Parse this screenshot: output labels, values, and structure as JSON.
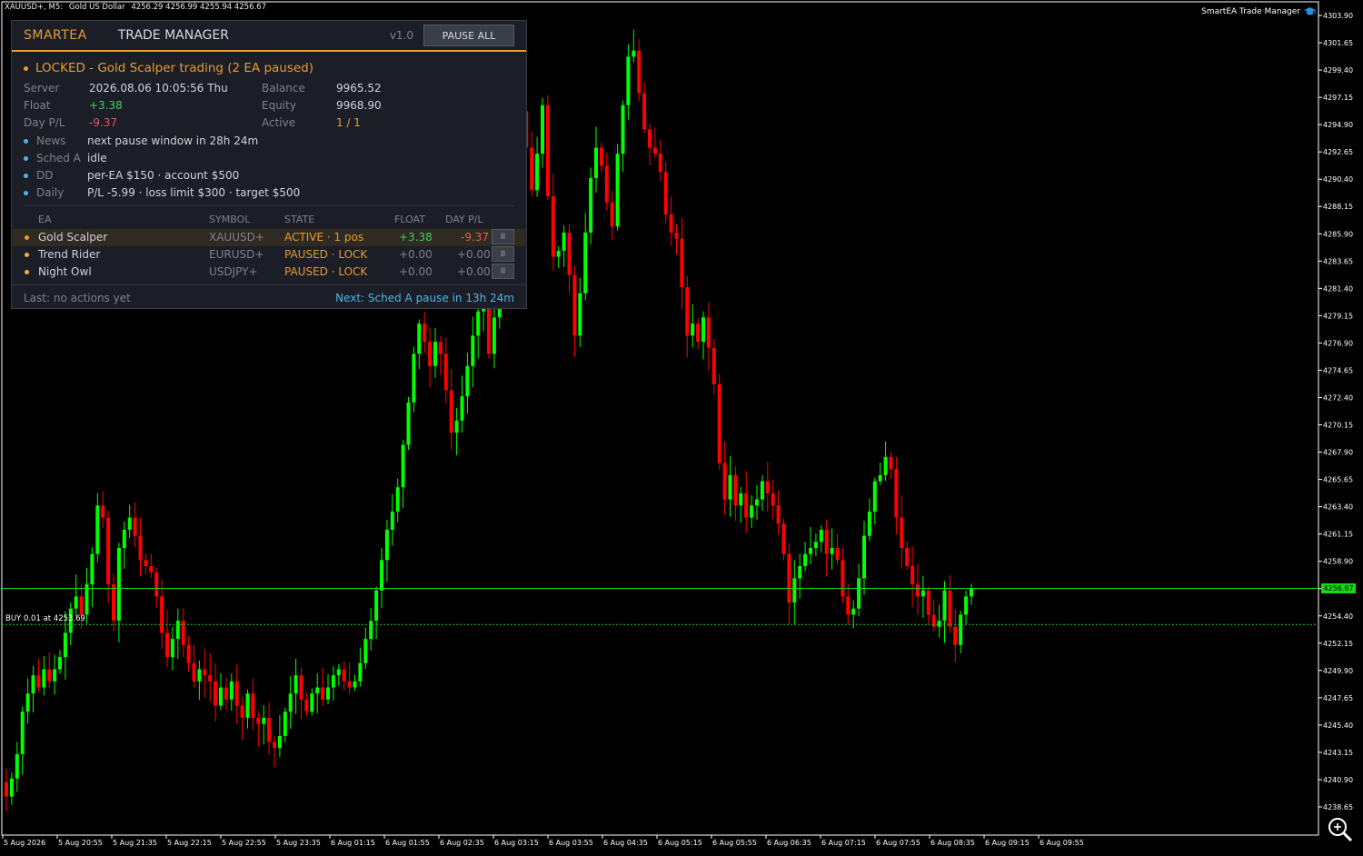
{
  "chart": {
    "symbol_info": "XAUUSD+, M5:",
    "description": "Gold US Dollar",
    "ohlc": "4256.29 4256.99 4255.94 4256.67",
    "brand": "SmartEA Trade Manager",
    "current_price": "4256.67",
    "buy_label": "BUY 0.01 at 4253.69",
    "colors": {
      "bull": "#00ff00",
      "bear": "#ff0000",
      "background": "#000000",
      "grid": "#ffffff"
    }
  },
  "chart_data": {
    "type": "candlestick",
    "title": "",
    "ylim": [
      4237.2,
      4304.2
    ],
    "y_ticks": [
      "4303.90",
      "4301.65",
      "4299.40",
      "4297.15",
      "4294.90",
      "4292.65",
      "4290.40",
      "4288.15",
      "4285.90",
      "4283.65",
      "4281.40",
      "4279.15",
      "4276.90",
      "4274.65",
      "4272.40",
      "4270.15",
      "4267.90",
      "4265.65",
      "4263.40",
      "4261.15",
      "4258.90",
      "4256.65",
      "4254.40",
      "4252.15",
      "4249.90",
      "4247.65",
      "4245.40",
      "4243.15",
      "4240.90",
      "4238.65"
    ],
    "x_ticks": [
      "5 Aug 2026",
      "5 Aug 20:55",
      "5 Aug 21:35",
      "5 Aug 22:15",
      "5 Aug 22:55",
      "5 Aug 23:35",
      "6 Aug 01:15",
      "6 Aug 01:55",
      "6 Aug 02:35",
      "6 Aug 03:15",
      "6 Aug 03:55",
      "6 Aug 04:35",
      "6 Aug 05:15",
      "6 Aug 05:55",
      "6 Aug 06:35",
      "6 Aug 07:15",
      "6 Aug 07:55",
      "6 Aug 08:35",
      "6 Aug 09:15",
      "6 Aug 09:55"
    ],
    "current_price": 4256.67,
    "buy_price": 4253.69,
    "closes": [
      4239.5,
      4241.0,
      4243.0,
      4246.5,
      4248.0,
      4249.5,
      4248.5,
      4250.0,
      4249.0,
      4250.0,
      4251.0,
      4253.0,
      4255.0,
      4256.0,
      4254.5,
      4257.0,
      4259.5,
      4263.5,
      4262.5,
      4257.0,
      4254.0,
      4260.0,
      4261.5,
      4262.5,
      4261.0,
      4259.0,
      4258.5,
      4258.0,
      4256.0,
      4253.0,
      4251.0,
      4252.5,
      4254.0,
      4252.0,
      4250.5,
      4249.0,
      4250.0,
      4249.5,
      4249.0,
      4247.0,
      4248.5,
      4247.5,
      4249.0,
      4247.0,
      4246.0,
      4248.0,
      4246.0,
      4245.5,
      4246.0,
      4244.0,
      4243.5,
      4244.5,
      4246.5,
      4248.0,
      4249.5,
      4247.5,
      4246.5,
      4248.0,
      4248.5,
      4247.5,
      4248.5,
      4249.5,
      4250.0,
      4249.0,
      4248.5,
      4249.0,
      4250.5,
      4252.5,
      4254.0,
      4256.5,
      4259.0,
      4261.5,
      4263.0,
      4265.0,
      4268.5,
      4272.0,
      4276.0,
      4278.5,
      4277.0,
      4275.0,
      4277.0,
      4276.0,
      4273.0,
      4269.5,
      4270.5,
      4272.5,
      4275.0,
      4277.5,
      4279.5,
      4280.5,
      4276.0,
      4279.0,
      4283.0,
      4286.0,
      4290.0,
      4295.5,
      4296.0,
      4293.0,
      4289.5,
      4292.5,
      4296.5,
      4289.0,
      4284.0,
      4284.5,
      4286.0,
      4282.5,
      4277.5,
      4281.0,
      4286.0,
      4290.5,
      4293.0,
      4291.5,
      4288.5,
      4286.5,
      4292.5,
      4296.5,
      4300.5,
      4301.0,
      4297.5,
      4294.5,
      4293.0,
      4292.5,
      4291.0,
      4287.5,
      4286.0,
      4285.5,
      4281.5,
      4277.5,
      4278.5,
      4277.0,
      4279.0,
      4276.5,
      4273.5,
      4267.0,
      4264.0,
      4266.0,
      4263.5,
      4264.5,
      4262.5,
      4263.5,
      4264.0,
      4265.5,
      4264.5,
      4263.5,
      4262.0,
      4259.5,
      4255.5,
      4257.5,
      4258.5,
      4259.5,
      4260.0,
      4260.5,
      4261.5,
      4259.5,
      4260.0,
      4259.0,
      4256.0,
      4254.5,
      4255.0,
      4257.5,
      4261.0,
      4263.0,
      4265.5,
      4266.0,
      4267.5,
      4266.5,
      4262.5,
      4260.0,
      4258.5,
      4257.0,
      4256.0,
      4256.5,
      4254.5,
      4253.5,
      4254.0,
      4256.5,
      4253.5,
      4252.0,
      4254.5,
      4256.0,
      4256.67
    ]
  },
  "panel": {
    "brand": "SMARTEA",
    "title": "TRADE MANAGER",
    "version": "v1.0",
    "pause_all": "PAUSE ALL",
    "status": "LOCKED - Gold Scalper trading  (2 EA paused)",
    "server_label": "Server",
    "server_value": "2026.08.06 10:05:56 Thu",
    "float_label": "Float",
    "float_value": "+3.38",
    "daypl_label": "Day P/L",
    "daypl_value": "-9.37",
    "balance_label": "Balance",
    "balance_value": "9965.52",
    "equity_label": "Equity",
    "equity_value": "9968.90",
    "active_label": "Active",
    "active_value": "1 / 1",
    "news_label": "News",
    "news_value": "next pause window in 28h 24m",
    "sched_label": "Sched A",
    "sched_value": "idle",
    "dd_label": "DD",
    "dd_value": "per-EA $150  ·  account $500",
    "daily_label": "Daily",
    "daily_value": "P/L -5.99  ·  loss limit $300  ·  target $500",
    "table_headers": {
      "ea": "EA",
      "symbol": "SYMBOL",
      "state": "STATE",
      "float": "FLOAT",
      "daypl": "DAY P/L"
    },
    "rows": [
      {
        "ea": "Gold Scalper",
        "symbol": "XAUUSD+",
        "state": "ACTIVE · 1 pos",
        "float": "+3.38",
        "daypl": "-9.37",
        "btn": "II"
      },
      {
        "ea": "Trend Rider",
        "symbol": "EURUSD+",
        "state": "PAUSED · LOCK",
        "float": "+0.00",
        "daypl": "+0.00",
        "btn": "II"
      },
      {
        "ea": "Night Owl",
        "symbol": "USDJPY+",
        "state": "PAUSED · LOCK",
        "float": "+0.00",
        "daypl": "+0.00",
        "btn": "II"
      }
    ],
    "last_label": "Last:  no actions yet",
    "next_label": "Next:  Sched A pause in 13h 24m"
  }
}
